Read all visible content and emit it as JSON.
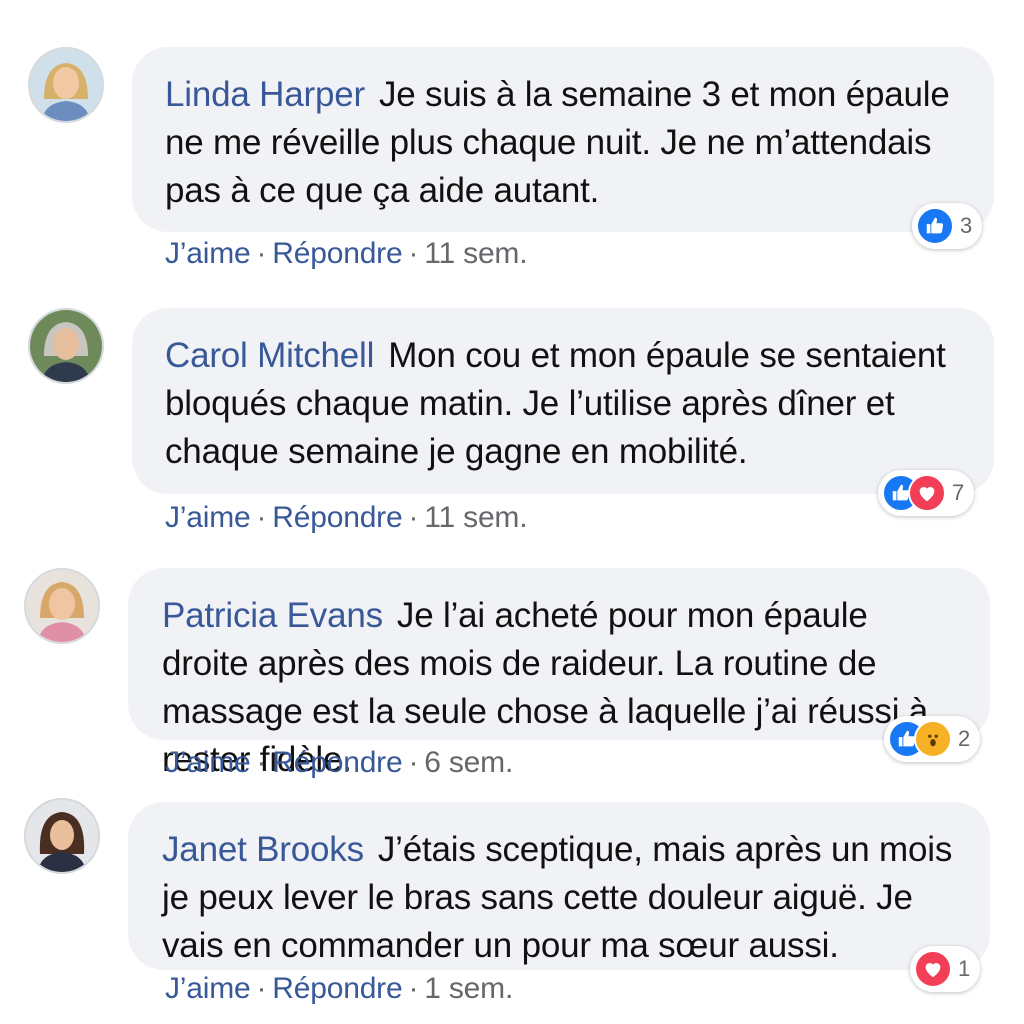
{
  "colors": {
    "author": "#385898",
    "bubble": "#f0f2f5",
    "like": "#1877f2",
    "love": "#f33e58",
    "wow": "#f7b125"
  },
  "comments": [
    {
      "author": "Linda Harper",
      "text": "Je suis à la semaine 3 et mon épaule ne me réveille plus chaque nuit. Je ne m’attendais pas à ce que ça aide autant.",
      "reactions": [
        "like-icon"
      ],
      "reaction_count": "3",
      "like_label": "J’aime",
      "reply_label": "Répondre",
      "time": "11 sem."
    },
    {
      "author": "Carol Mitchell",
      "text": "Mon cou et mon épaule se sentaient bloqués chaque matin. Je l’utilise après dîner et chaque semaine je gagne en mobilité.",
      "reactions": [
        "like-icon",
        "love-icon"
      ],
      "reaction_count": "7",
      "like_label": "J’aime",
      "reply_label": "Répondre",
      "time": "11 sem."
    },
    {
      "author": "Patricia Evans",
      "text": "Je l’ai acheté pour mon épaule droite après des mois de raideur. La routine de massage est la seule chose à laquelle j’ai réussi à rester fidèle.",
      "reactions": [
        "like-icon",
        "wow-icon"
      ],
      "reaction_count": "2",
      "like_label": "J’aime",
      "reply_label": "Répondre",
      "time": "6 sem."
    },
    {
      "author": "Janet Brooks",
      "text": "J’étais sceptique, mais après un mois je peux lever le bras sans cette douleur aiguë. Je vais en commander un pour ma sœur aussi.",
      "reactions": [
        "love-icon"
      ],
      "reaction_count": "1",
      "like_label": "J’aime",
      "reply_label": "Répondre",
      "time": "1 sem."
    }
  ]
}
